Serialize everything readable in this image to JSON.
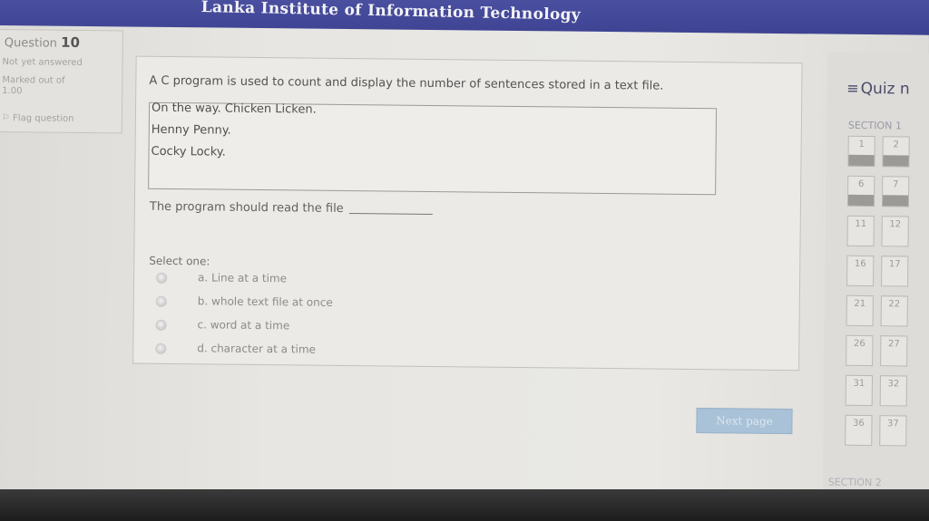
{
  "header": {
    "title": "Lanka Institute of Information Technology"
  },
  "info": {
    "question_label": "Question",
    "question_number": "10",
    "status": "Not yet answered",
    "marked_out_of": "Marked out of",
    "marks": "1.00",
    "flag_label": "Flag question"
  },
  "question": {
    "text": "A C program is used to count and display the number of sentences stored in a text file.",
    "file_lines": [
      "On the way. Chicken Licken.",
      "Henny Penny.",
      "Cocky Locky."
    ],
    "prompt": "The program should read the file",
    "select_label": "Select one:",
    "options": [
      {
        "label": "a. Line at a time"
      },
      {
        "label": "b. whole text file at once"
      },
      {
        "label": "c. word at a time"
      },
      {
        "label": "d. character at a time"
      }
    ]
  },
  "next_button": "Next page",
  "quiz_nav": {
    "title": "Quiz n",
    "section1": "SECTION 1",
    "section2": "SECTION 2",
    "numbers": [
      "1",
      "2",
      "6",
      "7",
      "11",
      "12",
      "16",
      "17",
      "21",
      "22",
      "26",
      "27",
      "31",
      "32",
      "36",
      "37"
    ],
    "answered": [
      true,
      true,
      true,
      true,
      false,
      false,
      false,
      false,
      false,
      false,
      false,
      false,
      false,
      false,
      false,
      false
    ]
  }
}
